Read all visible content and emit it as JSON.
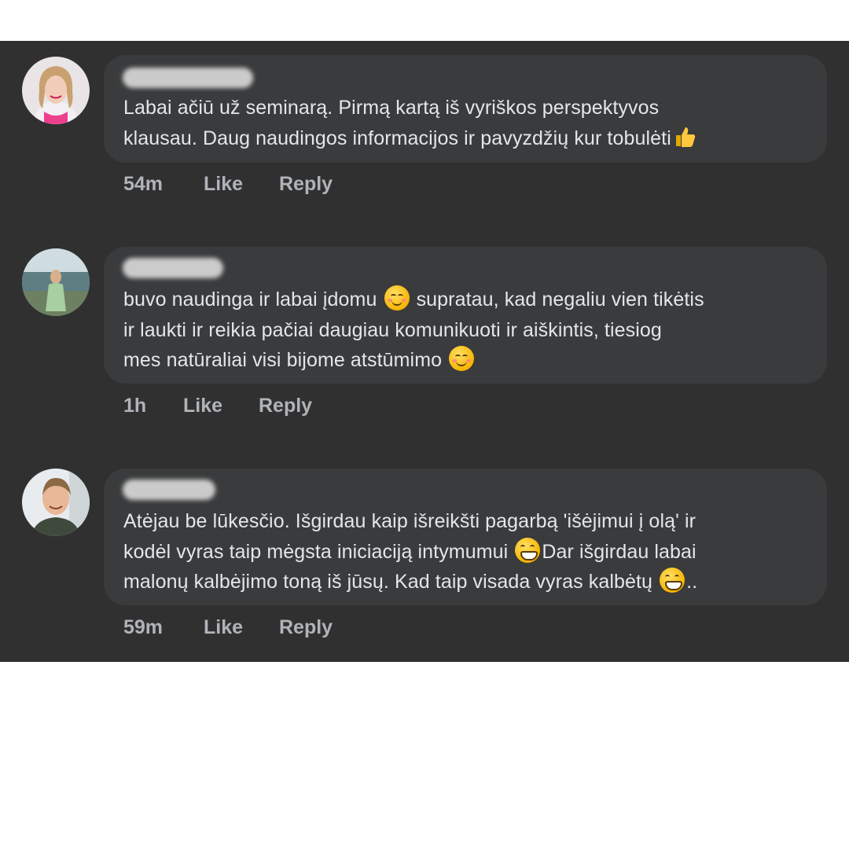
{
  "comments": [
    {
      "time": "54m",
      "like_label": "Like",
      "reply_label": "Reply",
      "lines": [
        "Labai ačiū už seminarą. Pirmą kartą iš vyriškos perspektyvos",
        "klausau. Daug naudingos informacijos ir pavyzdžių kur tobulėti"
      ],
      "emoji": "thumbs-up-icon"
    },
    {
      "time": "1h",
      "like_label": "Like",
      "reply_label": "Reply",
      "line1_a": "buvo naudinga ir labai įdomu",
      "line1_b": "supratau, kad negaliu vien tikėtis",
      "line2": "ir laukti ir reikia pačiai daugiau komunikuoti ir aiškintis, tiesiog",
      "line3": "mes natūraliai visi bijome atstūmimo",
      "emoji": "smiling-blush-icon"
    },
    {
      "time": "59m",
      "like_label": "Like",
      "reply_label": "Reply",
      "line1": "Atėjau be lūkesčio. Išgirdau kaip išreikšti pagarbą 'išėjimui į olą' ir",
      "line2_a": "kodėl vyras taip mėgsta iniciaciją intymumui",
      "line2_b": "Dar išgirdau  labai",
      "line3_a": "malonų kalbėjimo toną iš jūsų. Kad taip visada vyras kalbėtų",
      "line3_b": "..",
      "emoji": "grinning-icon"
    }
  ],
  "colors": {
    "panel": "#303031",
    "bubble": "#3a3b3c",
    "text": "#e4e6eb",
    "meta": "#b0b3b8"
  }
}
